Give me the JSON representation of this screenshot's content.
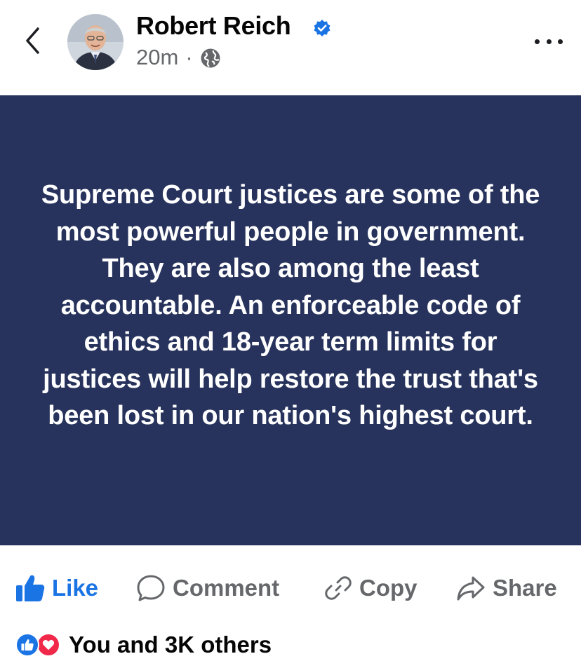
{
  "header": {
    "author_name": "Robert Reich",
    "timestamp": "20m",
    "separator": "·",
    "verified": true,
    "icons": {
      "back": "chevron-left-icon",
      "verified": "verified-badge-icon",
      "audience": "globe-icon",
      "more": "more-horizontal-icon"
    }
  },
  "post": {
    "text": "Supreme Court justices are some of the most powerful people in government. They are also among the least accountable. An enforceable code of ethics and 18-year term limits for justices will help restore the trust that's been lost in our nation's highest court.",
    "background_color": "#27335c",
    "text_color": "#ffffff"
  },
  "actions": {
    "like_label": "Like",
    "comment_label": "Comment",
    "copy_label": "Copy",
    "share_label": "Share",
    "like_color": "#1b74e4",
    "icons": [
      "thumbs-up-icon",
      "comment-bubble-icon",
      "link-icon",
      "share-arrow-icon"
    ]
  },
  "reactions": {
    "summary": "You and 3K others",
    "types": [
      "like",
      "love"
    ]
  }
}
